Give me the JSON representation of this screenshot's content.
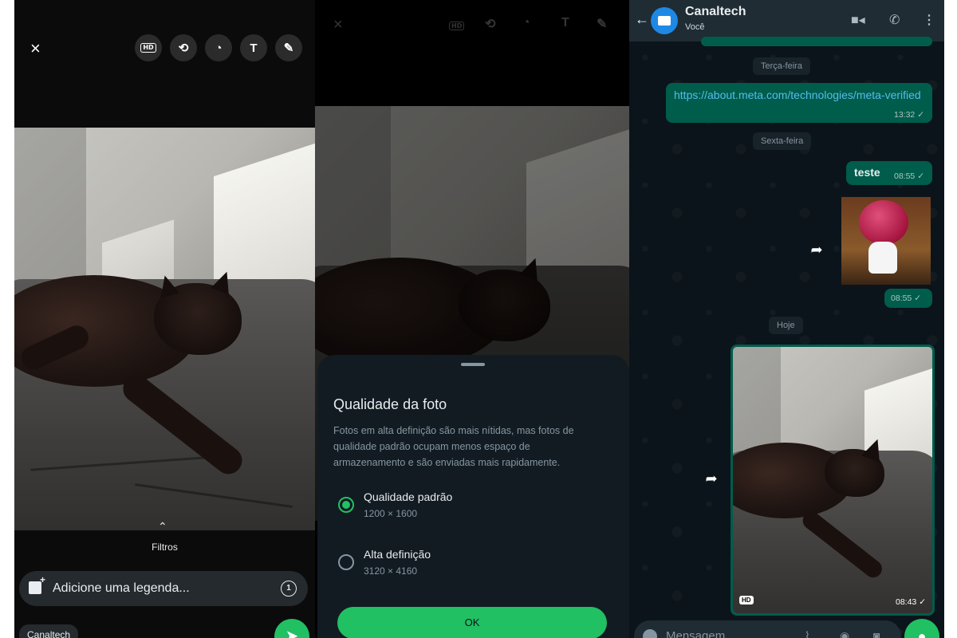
{
  "panel1": {
    "close_icon": "×",
    "tools": [
      "HD",
      "⟲",
      "◔",
      "T",
      "✎"
    ],
    "filters_label": "Filtros",
    "caption_placeholder": "Adicione uma legenda...",
    "timer_label": "1",
    "recipient_chip": "Canaltech",
    "send_icon": "➤"
  },
  "panel2": {
    "sheet_title": "Qualidade da foto",
    "sheet_description": "Fotos em alta definição são mais nítidas, mas fotos de qualidade padrão ocupam menos espaço de armazenamento e são enviadas mais rapidamente.",
    "options": [
      {
        "label": "Qualidade padrão",
        "resolution": "1200 × 1600",
        "selected": true
      },
      {
        "label": "Alta definição",
        "resolution": "3120 × 4160",
        "selected": false
      }
    ],
    "ok_label": "OK"
  },
  "panel3": {
    "contact_name": "Canaltech",
    "contact_sub": "Você",
    "date_1": "Terça-feira",
    "link_text": "https://about.meta.com/technologies/meta-verified",
    "link_time": "13:32 ✓",
    "date_2": "Sexta-feira",
    "teste_text": "teste",
    "teste_time": "08:55 ✓",
    "sticker_time": "08:55 ✓",
    "date_3": "Hoje",
    "hd_badge": "HD",
    "image_time": "08:43 ✓",
    "input_placeholder": "Mensagem",
    "forward_icon": "➦",
    "colors": {
      "accent": "#21c063",
      "bubble": "#005c4b",
      "link": "#53bdeb"
    }
  }
}
